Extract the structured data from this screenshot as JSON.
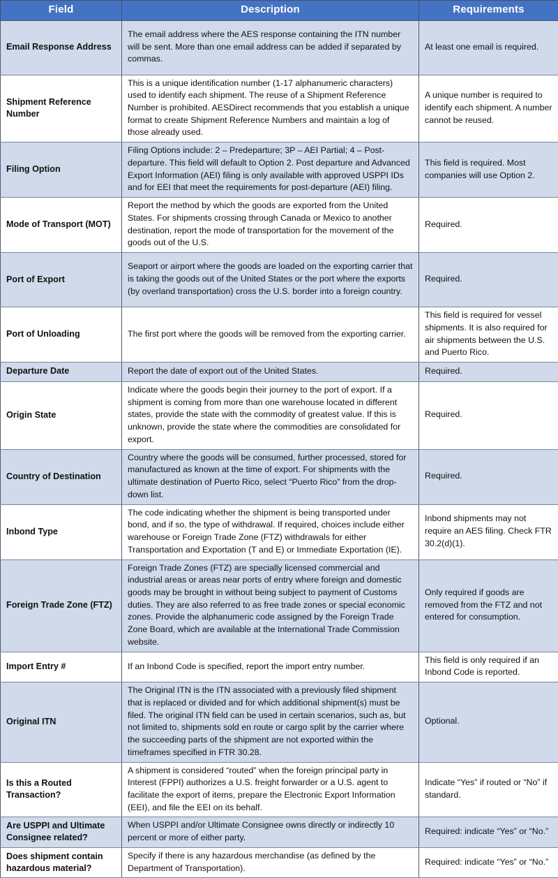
{
  "table": {
    "columns": [
      {
        "label": "Field",
        "name": "column-header-field"
      },
      {
        "label": "Description",
        "name": "column-header-description"
      },
      {
        "label": "Requirements",
        "name": "column-header-requirements"
      }
    ],
    "rows": [
      {
        "field": "Email Response Address",
        "description": "The email address where the AES response containing the ITN number will be sent. More than one email address can be added if separated by commas.",
        "requirements": "At least one email is required."
      },
      {
        "field": "Shipment Reference Number",
        "description": "This is a unique identification number (1-17 alphanumeric characters) used to identify each shipment. The reuse of a Shipment Reference Number is prohibited. AESDirect recommends that you establish a unique format to create Shipment Reference Numbers and maintain a log of those already used.",
        "requirements": "A unique number is required to identify each shipment. A number cannot be reused."
      },
      {
        "field": "Filing Option",
        "description": "Filing Options include: 2 – Predeparture; 3P – AEI Partial; 4 – Post-departure. This field will default to Option 2. Post departure and Advanced Export Information (AEI) filing is only available with approved USPPI IDs and for EEI that meet the requirements for post-departure (AEI) filing.",
        "requirements": "This field is required. Most companies will use Option 2."
      },
      {
        "field": "Mode of Transport (MOT)",
        "description": "Report the method by which the goods are exported from the United States. For shipments crossing through Canada or Mexico to another destination, report the mode of transportation for the movement of the goods out of the U.S.",
        "requirements": "Required."
      },
      {
        "field": "Port of Export",
        "description": "Seaport or airport where the goods are loaded on the exporting carrier that is taking the goods out of the United States or the port where the exports (by overland transportation) cross the U.S. border into a foreign country.",
        "requirements": "Required."
      },
      {
        "field": "Port of Unloading",
        "description": "The first port where the goods will be removed from the exporting carrier.",
        "requirements": "This field is required for vessel shipments. It is also required for air shipments between the U.S. and Puerto Rico."
      },
      {
        "field": "Departure Date",
        "description": "Report the date of export out of the United States.",
        "requirements": "Required."
      },
      {
        "field": "Origin State",
        "description": "Indicate where the goods begin their journey to the port of export. If a shipment is coming from more than one warehouse located in different states, provide the state with the commodity of greatest value. If this is unknown, provide the state where the commodities are consolidated for export.",
        "requirements": "Required."
      },
      {
        "field": "Country of Destination",
        "description": "Country where the goods will be consumed, further processed, stored for manufactured as known at the time of export. For shipments with the ultimate destination of Puerto Rico, select “Puerto Rico” from the drop-down list.",
        "requirements": "Required."
      },
      {
        "field": "Inbond Type",
        "description": "The code indicating whether the shipment is being transported under bond, and if so, the type of withdrawal. If required, choices include either warehouse or Foreign Trade Zone (FTZ) withdrawals for either Transportation and Exportation (T and E) or Immediate Exportation (IE).",
        "requirements": "Inbond shipments may not require an AES filing. Check FTR 30.2(d)(1)."
      },
      {
        "field": "Foreign Trade Zone (FTZ)",
        "description": "Foreign Trade Zones (FTZ) are specially licensed commercial and industrial areas or areas near ports of entry where foreign and domestic goods may be brought in without being subject to payment of Customs duties. They are also referred to as free trade zones or special economic zones. Provide the alphanumeric code assigned by the Foreign Trade Zone Board, which are available at the International Trade Commission website.",
        "requirements": "Only required if goods are removed from the FTZ and not entered for consumption."
      },
      {
        "field": "Import Entry #",
        "description": "If an Inbond Code is specified, report the import entry number.",
        "requirements": "This field is only required if an Inbond Code is reported."
      },
      {
        "field": "Original ITN",
        "description": "The Original ITN is the ITN associated with a previously filed shipment that is replaced or divided and for which additional shipment(s) must be filed. The original ITN field can be used in certain scenarios, such as, but not limited to, shipments sold en route or cargo split by the carrier where the succeeding parts of the shipment are not exported within the timeframes specified in FTR 30.28.",
        "requirements": "Optional."
      },
      {
        "field": "Is this a Routed Transaction?",
        "description": "A shipment is considered “routed” when the foreign principal party in Interest (FPPI) authorizes a U.S. freight forwarder or a U.S. agent to facilitate the export of items, prepare the Electronic Export Information (EEI), and file the EEI on its behalf.",
        "requirements": "Indicate “Yes” if routed or “No” if standard."
      },
      {
        "field": "Are USPPI and Ultimate Consignee related?",
        "description": "When USPPI and/or Ultimate Consignee owns directly or indirectly 10 percent or more of either party.",
        "requirements": "Required: indicate “Yes” or “No.”"
      },
      {
        "field": "Does shipment contain hazardous material?",
        "description": "Specify if there is any hazardous merchandise (as defined by the Department of Transportation).",
        "requirements": "Required: indicate “Yes” or “No.”"
      }
    ]
  },
  "colors": {
    "header_background": "#4573c4",
    "header_text": "#ffffff",
    "row_shade": "#d0daeb",
    "row_plain": "#ffffff",
    "border": "#4a5b77"
  }
}
